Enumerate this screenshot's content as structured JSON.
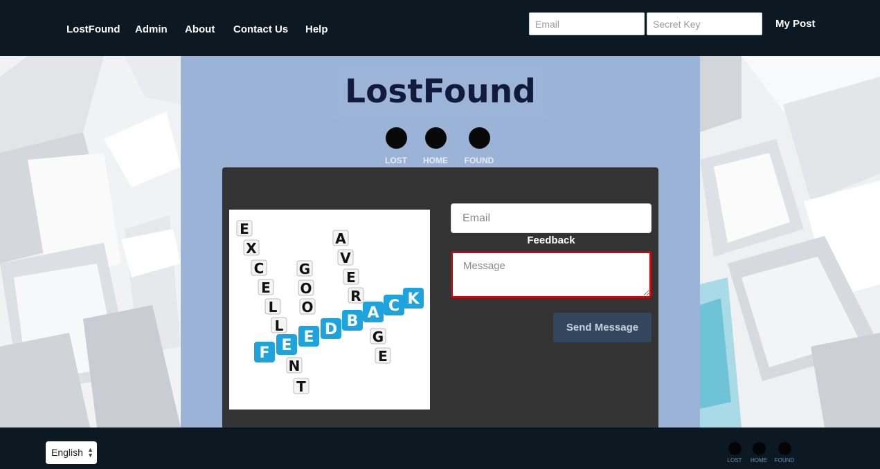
{
  "navbar": {
    "links": [
      "LostFound",
      "Admin",
      "About",
      "Contact Us",
      "Help"
    ],
    "email_placeholder": "Email",
    "secret_key_placeholder": "Secret Key",
    "my_post": "My Post"
  },
  "hero": {
    "title": "LostFound",
    "nav": [
      "LOST",
      "HOME",
      "FOUND"
    ]
  },
  "feedback_form": {
    "image_words": [
      "EXCELLENT",
      "GOOD",
      "AVERAGE",
      "FEEDBACK"
    ],
    "email_placeholder": "Email",
    "label": "Feedback",
    "message_placeholder": "Message",
    "send_label": "Send Message"
  },
  "footer": {
    "language": "English",
    "nav": [
      "LOST",
      "HOME",
      "FOUND"
    ]
  },
  "colors": {
    "navbar_bg": "#0c1923",
    "panel_bg": "#9cb3d8",
    "card_bg": "#333333",
    "title_color": "#131b3d",
    "send_button": "#34465d",
    "message_border": "#c40b0b",
    "tile_blue": "#1ea3dc"
  },
  "icons": [
    "chevron-up-down-icon"
  ]
}
